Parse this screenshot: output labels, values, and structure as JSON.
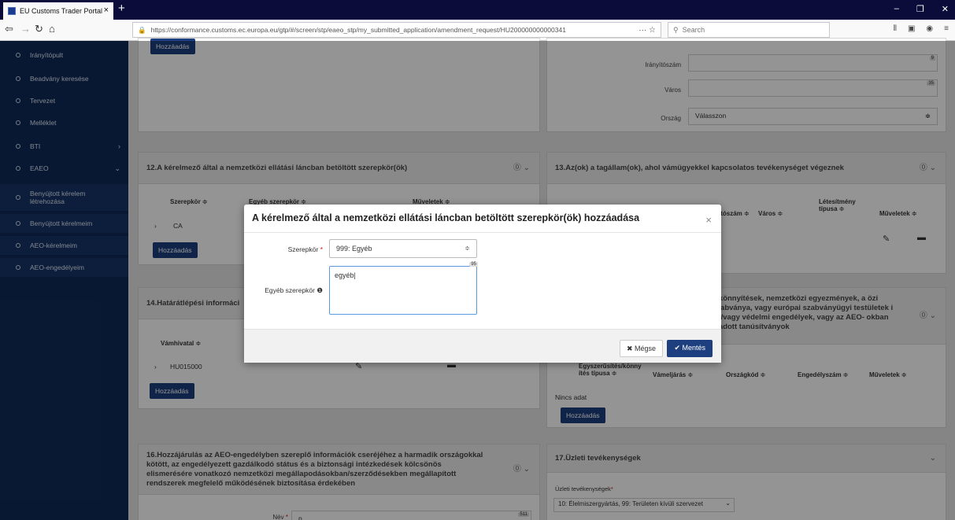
{
  "browser": {
    "tab_title": "EU Customs Trader Portal",
    "url": "https://conformance.customs.ec.europa.eu/gtp/#/screen/stp/eaeo_stp/my_submitted_application/amendment_request/HU200000000000341",
    "search_placeholder": "Search"
  },
  "sidebar": {
    "items": [
      {
        "label": "Irányítópult"
      },
      {
        "label": "Beadvány keresése"
      },
      {
        "label": "Tervezet"
      },
      {
        "label": "Melléklet"
      },
      {
        "label": "BTI"
      },
      {
        "label": "EAEO"
      },
      {
        "label": "Benyújtott kérelem létrehozása"
      },
      {
        "label": "Benyújtott kérelmeim"
      },
      {
        "label": "AEO-kérelmeim"
      },
      {
        "label": "AEO-engedélyeim"
      }
    ]
  },
  "top_left": {
    "add_button": "Hozzáadás"
  },
  "address_form": {
    "zip_label": "Irányítószám",
    "zip_counter": "9",
    "city_label": "Város",
    "city_counter": "35",
    "country_label": "Ország",
    "country_value": "Válasszon"
  },
  "panel12": {
    "title": "12.A kérelmező által a nemzetközi ellátási láncban betöltött szerepkör(ök)",
    "col1": "Szerepkör ≑",
    "col2": "Egyéb szerepkör ≑",
    "col3": "Műveletek ≑",
    "row_value": "CA",
    "add_button": "Hozzáadás"
  },
  "panel13": {
    "title": "13.Az(ok) a tagállam(ok), ahol vámügyekkel kapcsolatos tevékenységet végeznek",
    "col_zip": "ítószám ≑",
    "col_city": "Város ≑",
    "col_type": "Létesítmény típusa ≑",
    "col_ops": "Műveletek ≑"
  },
  "panel14": {
    "title": "14.Határátlépési informáci",
    "col1": "Vámhivatal ≑",
    "row_value": "HU015000",
    "add_button": "Hozzáadás"
  },
  "panel15": {
    "title": "s könnyítések, nemzetközi egyezmények, a özi szabványa, vagy európai szabványügyi testületek i és/vagy védelmi engedélyek, vagy az AEO- okban kiadott tanúsítványok",
    "col1": "Egyszerűsítés/könny ítés típusa ≑",
    "col2": "Vámeljárás ≑",
    "col3": "Országkód ≑",
    "col4": "Engedélyszám ≑",
    "col5": "Műveletek ≑",
    "empty": "Nincs adat",
    "add_button": "Hozzáadás"
  },
  "panel16": {
    "title": "16.Hozzájárulás az AEO-engedélyben szereplő információk cseréjéhez a harmadik országokkal kötött, az engedélyezett gazdálkodó státus és a biztonsági intézkedések kölcsönös elismerésére vonatkozó nemzetközi megállapodásokban/szerződésekben megállapított rendszerek megfelelő működésének biztosítása érdekében",
    "name_label": "Név",
    "name_value": "p",
    "name_counter": "511"
  },
  "panel17": {
    "title": "17.Üzleti tevékenységek",
    "field_label": "Üzleti tevékenységek",
    "field_value": "10: Élelmiszergyártás, 99: Területen kívüli szervezet"
  },
  "modal": {
    "title": "A kérelmező által a nemzetközi ellátási láncban betöltött szerepkör(ök) hozzáadása",
    "role_label": "Szerepkör",
    "role_value": "999: Egyéb",
    "other_label": "Egyéb szerepkör",
    "other_value": "egyéb|",
    "other_counter": "95",
    "cancel": "Mégse",
    "save": "Mentés"
  }
}
